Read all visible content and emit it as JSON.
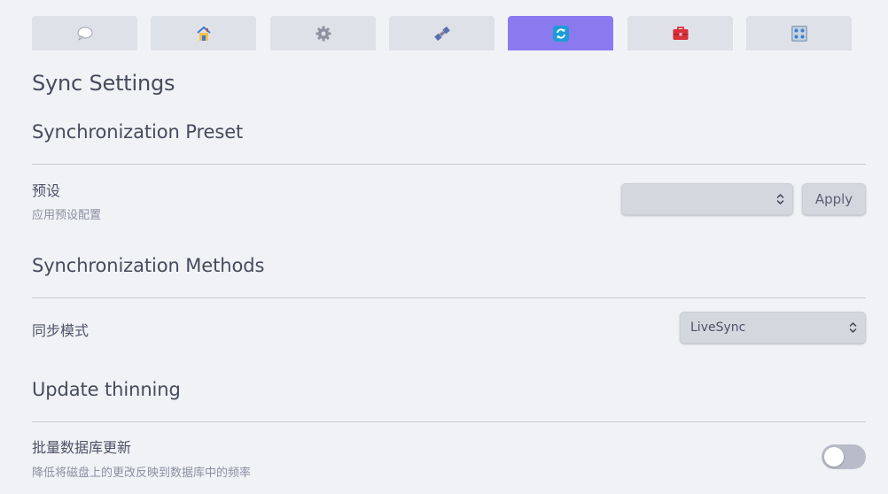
{
  "tabs": [
    {
      "icon": "speech-bubble-icon",
      "active": false
    },
    {
      "icon": "house-icon",
      "active": false
    },
    {
      "icon": "gear-icon",
      "active": false
    },
    {
      "icon": "satellite-icon",
      "active": false
    },
    {
      "icon": "sync-arrows-icon",
      "active": true
    },
    {
      "icon": "toolbox-icon",
      "active": false
    },
    {
      "icon": "control-knobs-icon",
      "active": false
    }
  ],
  "colors": {
    "active_tab": "#8b79f0",
    "sync_icon": "#1e9bd6",
    "toolbox_icon": "#d9303a",
    "toggle_off": "#b9bcc8"
  },
  "page": {
    "title": "Sync Settings"
  },
  "sections": {
    "preset": {
      "heading": "Synchronization Preset",
      "setting_name": "预设",
      "setting_desc": "应用预设配置",
      "select_value": "",
      "apply_label": "Apply"
    },
    "methods": {
      "heading": "Synchronization Methods",
      "setting_name": "同步模式",
      "select_value": "LiveSync"
    },
    "thinning": {
      "heading": "Update thinning",
      "setting_name": "批量数据库更新",
      "setting_desc": "降低将磁盘上的更改反映到数据库中的频率",
      "toggle_on": false
    }
  }
}
